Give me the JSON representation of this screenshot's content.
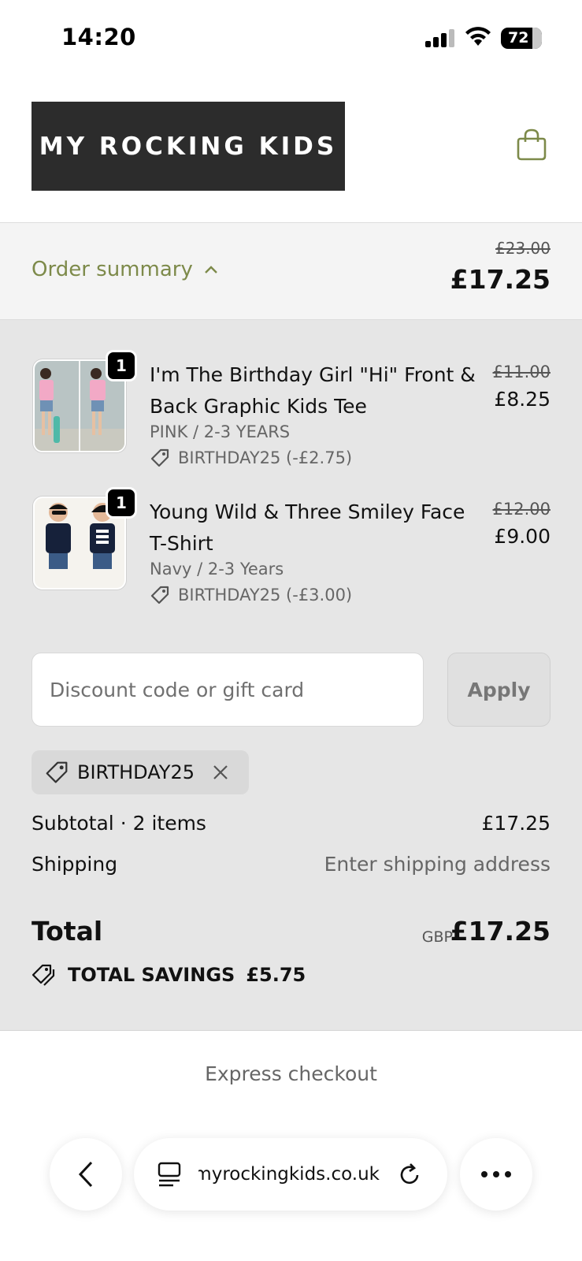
{
  "status_bar": {
    "time": "14:20",
    "battery": "72",
    "icons": [
      "signal-icon",
      "wifi-icon",
      "battery-icon"
    ]
  },
  "header": {
    "logo_text": "MY ROCKING KIDS",
    "cart_icon": "shopping-bag-icon"
  },
  "summary": {
    "toggle_label": "Order summary",
    "original_total": "£23.00",
    "total": "£17.25"
  },
  "items": [
    {
      "quantity": "1",
      "title": "I'm The Birthday Girl \"Hi\" Front & Back Graphic Kids Tee",
      "variant": "PINK / 2-3 YEARS",
      "discount": "BIRTHDAY25 (-£2.75)",
      "original_price": "£11.00",
      "price": "£8.25"
    },
    {
      "quantity": "1",
      "title": "Young Wild & Three Smiley Face T-Shirt",
      "variant": "Navy / 2-3 Years",
      "discount": "BIRTHDAY25 (-£3.00)",
      "original_price": "£12.00",
      "price": "£9.00"
    }
  ],
  "discount_form": {
    "placeholder": "Discount code or gift card",
    "value": "",
    "apply_label": "Apply"
  },
  "applied_code": "BIRTHDAY25",
  "totals": {
    "subtotal_label": "Subtotal · 2 items",
    "subtotal_value": "£17.25",
    "shipping_label": "Shipping",
    "shipping_value": "Enter shipping address",
    "total_label": "Total",
    "currency": "GBP",
    "total_value": "£17.25",
    "savings_label": "TOTAL SAVINGS",
    "savings_value": "£5.75"
  },
  "express": {
    "label": "Express checkout"
  },
  "browser": {
    "url": "myrockingkids.co.uk"
  },
  "colors": {
    "accent": "#7d8a4a",
    "logo_bg": "#2c2c2c",
    "summary_bg": "#f4f4f4",
    "main_bg": "#e6e6e6"
  }
}
